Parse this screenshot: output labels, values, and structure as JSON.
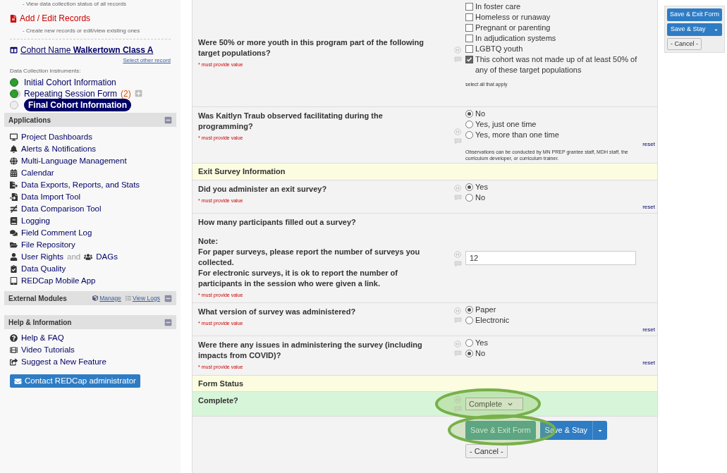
{
  "sidebar": {
    "top_note": "- View data collection status of all records",
    "add_edit": {
      "label": "Add / Edit Records",
      "note": "- Create new records or edit/view existing ones"
    },
    "record": {
      "label": "Cohort Name",
      "name": "Walkertown Class A",
      "link": "Select other record"
    },
    "instruments_label": "Data Collection Instruments:",
    "instruments": [
      {
        "label": "Initial Cohort Information",
        "complete": true,
        "repeating": false,
        "selected": false
      },
      {
        "label": "Repeating Session Form",
        "count": "(2)",
        "complete": true,
        "repeating": true,
        "selected": false
      },
      {
        "label": "Final Cohort Information",
        "complete": false,
        "repeating": false,
        "selected": true
      }
    ],
    "applications": {
      "title": "Applications",
      "items": [
        {
          "label": "Project Dashboards"
        },
        {
          "label": "Alerts & Notifications"
        },
        {
          "label": "Multi-Language Management"
        },
        {
          "label": "Calendar"
        },
        {
          "label": "Data Exports, Reports, and Stats"
        },
        {
          "label": "Data Import Tool"
        },
        {
          "label": "Data Comparison Tool"
        },
        {
          "label": "Logging"
        },
        {
          "label": "Field Comment Log"
        },
        {
          "label": "File Repository"
        },
        {
          "label": "User Rights",
          "joiner": "and",
          "second": "DAGs"
        },
        {
          "label": "Data Quality"
        },
        {
          "label": "REDCap Mobile App"
        }
      ]
    },
    "external_modules": {
      "title": "External Modules",
      "links": [
        "Manage",
        "View Logs"
      ]
    },
    "help": {
      "title": "Help & Information",
      "items": [
        "Help & FAQ",
        "Video Tutorials",
        "Suggest a New Feature"
      ],
      "contact_button": "Contact REDCap administrator"
    }
  },
  "form": {
    "rows": [
      {
        "kind": "checkbox",
        "question": [
          "Were 50% or more youth in this program part of the following target populations?"
        ],
        "required": "* must provide value",
        "options": [
          {
            "label": "In foster care",
            "checked": false
          },
          {
            "label": "Homeless or runaway",
            "checked": false
          },
          {
            "label": "Pregnant or parenting",
            "checked": false
          },
          {
            "label": "In adjudication systems",
            "checked": false
          },
          {
            "label": "LGBTQ youth",
            "checked": false
          },
          {
            "label": "This cohort was not made up of at least 50% of any of these target populations",
            "checked": true
          }
        ],
        "note": "select all that apply"
      },
      {
        "kind": "radio",
        "question": [
          "Was Kaitlyn Traub observed facilitating during the programming?"
        ],
        "required": "* must provide value",
        "options": [
          {
            "label": "No",
            "selected": true
          },
          {
            "label": "Yes, just one time",
            "selected": false
          },
          {
            "label": "Yes, more than one time",
            "selected": false
          }
        ],
        "reset": "reset",
        "note": "Observations can be conducted by MN PREP grantee staff, MDH staff, the curriculum developer, or curriculum trainer."
      },
      {
        "kind": "header",
        "label": "Exit Survey Information"
      },
      {
        "kind": "radio",
        "question": [
          "Did you administer an exit survey?"
        ],
        "required": "* must provide value",
        "options": [
          {
            "label": "Yes",
            "selected": true
          },
          {
            "label": "No",
            "selected": false
          }
        ],
        "reset": "reset"
      },
      {
        "kind": "text",
        "question": [
          "How many participants filled out a survey?",
          "Note:",
          "For paper surveys, please report the number of surveys you collected.",
          "For electronic surveys, it is ok to report the number of participants in the session who were given a link."
        ],
        "required": "* must provide value",
        "value": "12"
      },
      {
        "kind": "radio",
        "question": [
          "What version of survey was administered?"
        ],
        "required": "* must provide value",
        "options": [
          {
            "label": "Paper",
            "selected": true
          },
          {
            "label": "Electronic",
            "selected": false
          }
        ],
        "reset": "reset"
      },
      {
        "kind": "radio",
        "question": [
          "Were there any issues in administering the survey (including impacts from COVID)?"
        ],
        "required": "* must provide value",
        "options": [
          {
            "label": "Yes",
            "selected": false
          },
          {
            "label": "No",
            "selected": true
          }
        ],
        "reset": "reset"
      },
      {
        "kind": "header",
        "label": "Form Status"
      },
      {
        "kind": "select",
        "question": [
          "Complete?"
        ],
        "value": "Complete"
      }
    ],
    "buttons": {
      "save_exit": "Save & Exit Form",
      "save_stay": "Save & Stay",
      "cancel": "- Cancel -"
    }
  },
  "floating_panel": {
    "save_exit": "Save & Exit Form",
    "save_stay": "Save & Stay",
    "cancel": "- Cancel -"
  },
  "annotations": {
    "circle_status_select": true,
    "circle_save_button": true
  }
}
